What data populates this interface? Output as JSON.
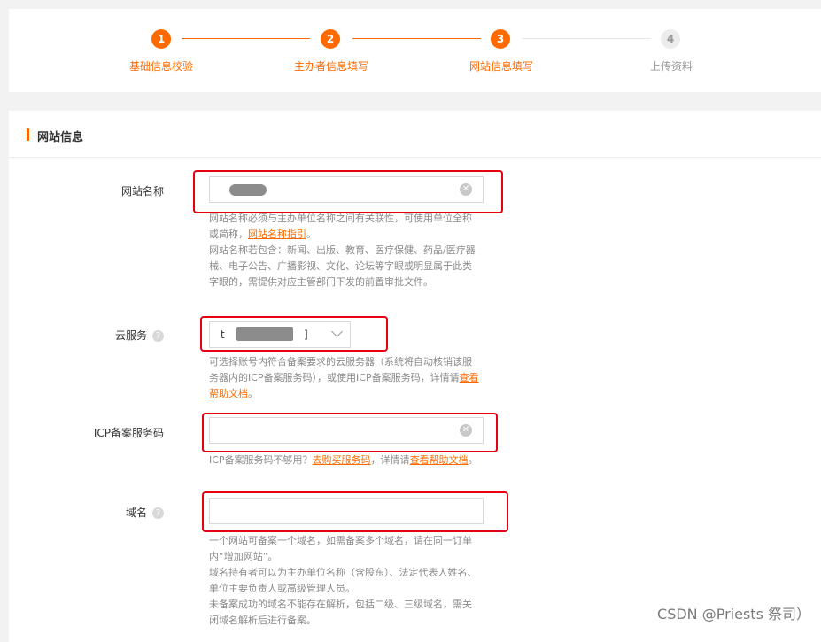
{
  "steps": [
    {
      "num": "1",
      "label": "基础信息校验"
    },
    {
      "num": "2",
      "label": "主办者信息填写"
    },
    {
      "num": "3",
      "label": "网站信息填写"
    },
    {
      "num": "4",
      "label": "上传资料"
    }
  ],
  "section_title": "网站信息",
  "site_name": {
    "label": "网站名称",
    "hint1": "网站名称必须与主办单位名称之间有关联性，可使用单位全称或简称，",
    "hint1_link": "网站名称指引",
    "hint1_end": "。",
    "hint2": "网站名称若包含：新闻、出版、教育、医疗保健、药品/医疗器械、电子公告、广播影视、文化、论坛等字眼或明显属于此类字眼的，需提供对应主管部门下发的前置审批文件。"
  },
  "cloud_service": {
    "label": "云服务",
    "value_prefix": "t",
    "value_suffix": "]",
    "hint": "可选择账号内符合备案要求的云服务器（系统将自动核销该服务器内的ICP备案服务码），或使用ICP备案服务码，详情请",
    "hint_link": "查看帮助文档",
    "hint_end": "。"
  },
  "icp_code": {
    "label": "ICP备案服务码",
    "hint_start": "ICP备案服务码不够用？",
    "hint_link1": "去购买服务码",
    "hint_mid": "，详情请",
    "hint_link2": "查看帮助文档",
    "hint_end": "。"
  },
  "domain": {
    "label": "域名",
    "hint1": "一个网站可备案一个域名，如需备案多个域名，请在同一订单内“增加网站”。",
    "hint2": "域名持有者可以为主办单位名称（含股东）、法定代表人姓名、单位主要负责人或高级管理人员。",
    "hint3": "未备案成功的域名不能存在解析，包括二级、三级域名，需关闭域名解析后进行备案。"
  },
  "help_mark": "?",
  "clear_mark": "✕",
  "watermark": "CSDN @Priests 祭司）",
  "colors": {
    "accent": "#ff6a00",
    "highlight_box": "#e60012"
  }
}
